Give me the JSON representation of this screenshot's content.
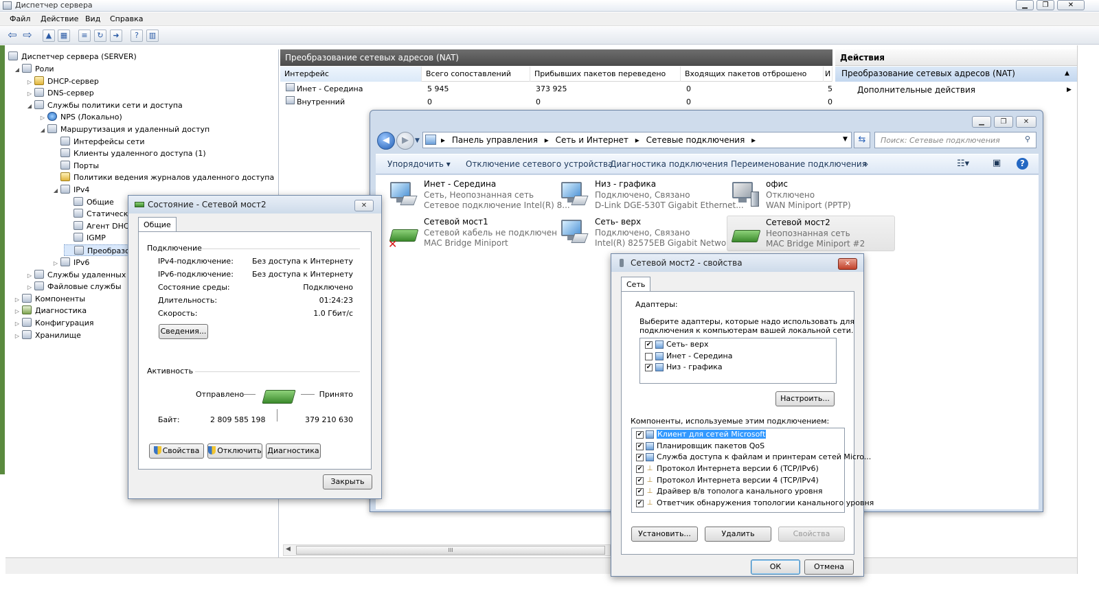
{
  "window": {
    "title": "Диспетчер сервера",
    "min": "▁",
    "max": "❐",
    "close": "✕"
  },
  "menu": [
    "Файл",
    "Действие",
    "Вид",
    "Справка"
  ],
  "tree": [
    {
      "label": "Диспетчер сервера (SERVER)",
      "arrow": ""
    },
    {
      "label": "Роли",
      "arrow": "◢"
    },
    {
      "label": "DHCP-сервер",
      "arrow": "▷"
    },
    {
      "label": "DNS-сервер",
      "arrow": "▷"
    },
    {
      "label": "Службы политики сети и доступа",
      "arrow": "◢"
    },
    {
      "label": "NPS (Локально)",
      "arrow": "▷"
    },
    {
      "label": "Маршрутизация и удаленный доступ",
      "arrow": "◢"
    },
    {
      "label": "Интерфейсы сети",
      "arrow": ""
    },
    {
      "label": "Клиенты удаленного доступа (1)",
      "arrow": ""
    },
    {
      "label": "Порты",
      "arrow": ""
    },
    {
      "label": "Политики ведения журналов удаленного доступа",
      "arrow": ""
    },
    {
      "label": "IPv4",
      "arrow": "◢"
    },
    {
      "label": "Общие",
      "arrow": ""
    },
    {
      "label": "Статическ",
      "arrow": ""
    },
    {
      "label": "Агент DHC",
      "arrow": ""
    },
    {
      "label": "IGMP",
      "arrow": ""
    },
    {
      "label": "Преобразо",
      "arrow": ""
    },
    {
      "label": "IPv6",
      "arrow": "▷"
    },
    {
      "label": "Службы удаленных р",
      "arrow": "▷"
    },
    {
      "label": "Файловые службы",
      "arrow": "▷"
    },
    {
      "label": "Компоненты",
      "arrow": "▷"
    },
    {
      "label": "Диагностика",
      "arrow": "▷"
    },
    {
      "label": "Конфигурация",
      "arrow": "▷"
    },
    {
      "label": "Хранилище",
      "arrow": "▷"
    }
  ],
  "nat": {
    "title": "Преобразование сетевых адресов (NAT)",
    "columns": [
      "Интерфейс",
      "Всего сопоставлений",
      "Прибывших пакетов переведено",
      "Входящих пакетов отброшено",
      "И"
    ],
    "rows": [
      {
        "iface": "Инет - Середина",
        "total": "5 945",
        "in": "373 925",
        "drop": "0",
        "i": "5"
      },
      {
        "iface": "Внутренний",
        "total": "0",
        "in": "0",
        "drop": "0",
        "i": "0"
      }
    ],
    "scroll_thumb": "III"
  },
  "actions": {
    "title": "Действия",
    "selected": "Преобразование сетевых адресов (NAT)",
    "more": "Дополнительные действия",
    "collapse": "▲",
    "more_arrow": "▶"
  },
  "netwin": {
    "breadcrumb": [
      "Панель управления",
      "Сеть и Интернет",
      "Сетевые подключения"
    ],
    "sep": "▸",
    "search_placeholder": "Поиск: Сетевые подключения",
    "commands": [
      "Упорядочить ▾",
      "Отключение сетевого устройства",
      "Диагностика подключения",
      "Переименование подключения",
      "»"
    ],
    "connections": [
      {
        "name": "Инет - Середина",
        "status": "Сеть, Неопознанная сеть",
        "device": "Сетевое подключение Intel(R) 8..."
      },
      {
        "name": "Низ - графика",
        "status": "Подключено, Связано",
        "device": "D-Link DGE-530T Gigabit Ethernet..."
      },
      {
        "name": "офис",
        "status": "Отключено",
        "device": "WAN Miniport (PPTP)"
      },
      {
        "name": "Сетевой мост1",
        "status": "Сетевой кабель не подключен",
        "device": "MAC Bridge Miniport"
      },
      {
        "name": "Сеть- верх",
        "status": "Подключено, Связано",
        "device": "Intel(R) 82575EB Gigabit Network ..."
      },
      {
        "name": "Сетевой мост2",
        "status": "Неопознанная сеть",
        "device": "MAC Bridge Miniport #2"
      }
    ]
  },
  "status": {
    "title": "Состояние - Сетевой мост2",
    "tab": "Общие",
    "connection_group": "Подключение",
    "fields": [
      {
        "k": "IPv4-подключение:",
        "v": "Без доступа к Интернету"
      },
      {
        "k": "IPv6-подключение:",
        "v": "Без доступа к Интернету"
      },
      {
        "k": "Состояние среды:",
        "v": "Подключено"
      },
      {
        "k": "Длительность:",
        "v": "01:24:23"
      },
      {
        "k": "Скорость:",
        "v": "1.0 Гбит/с"
      }
    ],
    "details_btn": "Сведения...",
    "activity_group": "Активность",
    "sent_label": "Отправлено",
    "recv_label": "Принято",
    "bytes_label": "Байт:",
    "bytes_sent": "2 809 585 198",
    "bytes_recv": "379 210 630",
    "props_btn": "Свойства",
    "disable_btn": "Отключить",
    "diag_btn": "Диагностика",
    "close_btn": "Закрыть"
  },
  "props": {
    "title": "Сетевой мост2 - свойства",
    "tab": "Сеть",
    "adapters_group": "Адаптеры:",
    "adapters_desc1": "Выберите адаптеры, которые надо использовать для",
    "adapters_desc2": "подключения к компьютерам вашей локальной сети.",
    "adapters": [
      {
        "label": "Сеть- верх",
        "checked": "✔"
      },
      {
        "label": "Инет - Середина",
        "checked": ""
      },
      {
        "label": "Низ - графика",
        "checked": "✔"
      }
    ],
    "configure_btn": "Настроить...",
    "components_label": "Компоненты, используемые этим подключением:",
    "components": [
      "Клиент для сетей Microsoft",
      "Планировщик пакетов QoS",
      "Служба доступа к файлам и принтерам сетей Micro...",
      "Протокол Интернета версии 6 (TCP/IPv6)",
      "Протокол Интернета версии 4 (TCP/IPv4)",
      "Драйвер в/в тополога канального уровня",
      "Ответчик обнаружения топологии канального уровня"
    ],
    "check": "✔",
    "install_btn": "Установить...",
    "remove_btn": "Удалить",
    "properties_btn": "Свойства",
    "ok_btn": "ОК",
    "cancel_btn": "Отмена"
  }
}
